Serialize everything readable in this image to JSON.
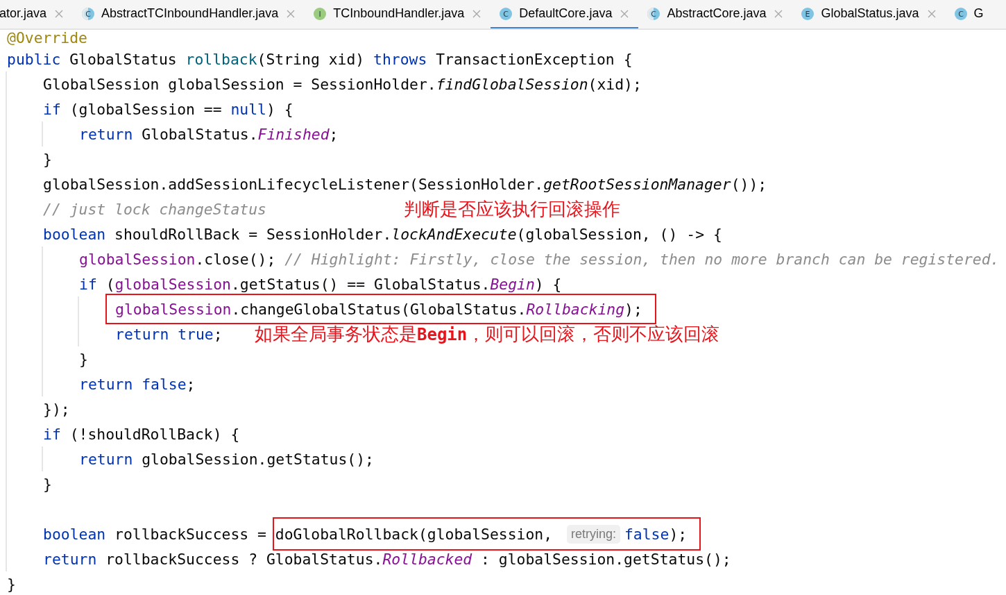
{
  "tabs": [
    {
      "label": "ator.java",
      "selected": false,
      "closable": true
    },
    {
      "label": "AbstractTCInboundHandler.java",
      "selected": false,
      "closable": true,
      "icon": {
        "kind": "abstract",
        "letter": "C"
      }
    },
    {
      "label": "TCInboundHandler.java",
      "selected": false,
      "closable": true,
      "icon": {
        "kind": "interface",
        "letter": "I"
      }
    },
    {
      "label": "DefaultCore.java",
      "selected": true,
      "closable": true,
      "icon": {
        "kind": "class",
        "letter": "C"
      }
    },
    {
      "label": "AbstractCore.java",
      "selected": false,
      "closable": true,
      "icon": {
        "kind": "abstract",
        "letter": "C"
      }
    },
    {
      "label": "GlobalStatus.java",
      "selected": false,
      "closable": true,
      "icon": {
        "kind": "enum",
        "letter": "E"
      }
    },
    {
      "label": "G",
      "selected": false,
      "closable": false,
      "icon": {
        "kind": "class",
        "letter": "C"
      }
    }
  ],
  "code": [
    {
      "kind": "line",
      "tokens": [
        {
          "kind": "annotation",
          "text": "@Override"
        }
      ]
    },
    {
      "kind": "line",
      "tokens": [
        {
          "kind": "keyword",
          "text": "public "
        },
        {
          "kind": "plain",
          "text": "GlobalStatus "
        },
        {
          "kind": "declaration",
          "text": "rollback"
        },
        {
          "kind": "plain",
          "text": "(String xid) "
        },
        {
          "kind": "keyword",
          "text": "throws "
        },
        {
          "kind": "plain",
          "text": "TransactionException {"
        }
      ]
    },
    {
      "kind": "block",
      "children": [
        {
          "kind": "line",
          "tokens": [
            {
              "kind": "plain",
              "text": "GlobalSession globalSession = SessionHolder."
            },
            {
              "kind": "static",
              "text": "findGlobalSession"
            },
            {
              "kind": "plain",
              "text": "(xid);"
            }
          ]
        },
        {
          "kind": "line",
          "tokens": [
            {
              "kind": "keyword",
              "text": "if "
            },
            {
              "kind": "plain",
              "text": "(globalSession == "
            },
            {
              "kind": "keyword",
              "text": "null"
            },
            {
              "kind": "plain",
              "text": ") {"
            }
          ]
        },
        {
          "kind": "block",
          "children": [
            {
              "kind": "line",
              "tokens": [
                {
                  "kind": "keyword",
                  "text": "return "
                },
                {
                  "kind": "plain",
                  "text": "GlobalStatus."
                },
                {
                  "kind": "constant",
                  "text": "Finished"
                },
                {
                  "kind": "plain",
                  "text": ";"
                }
              ]
            }
          ]
        },
        {
          "kind": "line",
          "tokens": [
            {
              "kind": "plain",
              "text": "}"
            }
          ]
        },
        {
          "kind": "line",
          "tokens": [
            {
              "kind": "plain",
              "text": "globalSession.addSessionLifecycleListener(SessionHolder."
            },
            {
              "kind": "static",
              "text": "getRootSessionManager"
            },
            {
              "kind": "plain",
              "text": "());"
            }
          ]
        },
        {
          "kind": "line",
          "tokens": [
            {
              "kind": "comment",
              "text": "// just lock changeStatus"
            },
            {
              "kind": "note",
              "text": "判断是否应该执行回滚操作"
            }
          ]
        },
        {
          "kind": "line",
          "tokens": [
            {
              "kind": "keyword",
              "text": "boolean "
            },
            {
              "kind": "plain",
              "text": "shouldRollBack = SessionHolder."
            },
            {
              "kind": "static",
              "text": "lockAndExecute"
            },
            {
              "kind": "plain",
              "text": "(globalSession, () -> {"
            }
          ]
        },
        {
          "kind": "block",
          "children": [
            {
              "kind": "line",
              "tokens": [
                {
                  "kind": "field",
                  "text": "globalSession"
                },
                {
                  "kind": "plain",
                  "text": ".close(); "
                },
                {
                  "kind": "comment",
                  "text": "// Highlight: Firstly, close the session, then no more branch can be registered."
                }
              ]
            },
            {
              "kind": "line",
              "tokens": [
                {
                  "kind": "keyword",
                  "text": "if "
                },
                {
                  "kind": "plain",
                  "text": "("
                },
                {
                  "kind": "field",
                  "text": "globalSession"
                },
                {
                  "kind": "plain",
                  "text": ".getStatus() == GlobalStatus."
                },
                {
                  "kind": "constant",
                  "text": "Begin"
                },
                {
                  "kind": "plain",
                  "text": ") {"
                }
              ]
            },
            {
              "kind": "block",
              "children": [
                {
                  "kind": "line",
                  "tokens": [
                    {
                      "kind": "boxed",
                      "tokens": [
                        {
                          "kind": "field",
                          "text": "globalSession"
                        },
                        {
                          "kind": "plain",
                          "text": ".changeGlobalStatus(GlobalStatus."
                        },
                        {
                          "kind": "constant",
                          "text": "Rollbacking"
                        },
                        {
                          "kind": "plain",
                          "text": ");"
                        }
                      ]
                    }
                  ]
                },
                {
                  "kind": "line",
                  "tokens": [
                    {
                      "kind": "keyword",
                      "text": "return "
                    },
                    {
                      "kind": "keyword",
                      "text": "true"
                    },
                    {
                      "kind": "plain",
                      "text": ";"
                    },
                    {
                      "kind": "note",
                      "text": "如果全局事务状态是**Begin**，则可以回滚，否则不应该回滚"
                    }
                  ]
                }
              ]
            },
            {
              "kind": "line",
              "tokens": [
                {
                  "kind": "plain",
                  "text": "}"
                }
              ]
            },
            {
              "kind": "line",
              "tokens": [
                {
                  "kind": "keyword",
                  "text": "return "
                },
                {
                  "kind": "keyword",
                  "text": "false"
                },
                {
                  "kind": "plain",
                  "text": ";"
                }
              ]
            }
          ]
        },
        {
          "kind": "line",
          "tokens": [
            {
              "kind": "plain",
              "text": "});"
            }
          ]
        },
        {
          "kind": "line",
          "tokens": [
            {
              "kind": "keyword",
              "text": "if "
            },
            {
              "kind": "plain",
              "text": "(!shouldRollBack) {"
            }
          ]
        },
        {
          "kind": "block",
          "children": [
            {
              "kind": "line",
              "tokens": [
                {
                  "kind": "keyword",
                  "text": "return "
                },
                {
                  "kind": "plain",
                  "text": "globalSession.getStatus();"
                }
              ]
            }
          ]
        },
        {
          "kind": "line",
          "tokens": [
            {
              "kind": "plain",
              "text": "}"
            }
          ]
        },
        {
          "kind": "line"
        },
        {
          "kind": "line",
          "tokens": [
            {
              "kind": "keyword",
              "text": "boolean "
            },
            {
              "kind": "plain",
              "text": "rollbackSuccess = "
            },
            {
              "kind": "boxed",
              "tokens": [
                {
                  "kind": "plain",
                  "text": "doGlobalRollback(globalSession, "
                },
                {
                  "kind": "hint",
                  "text": "retrying:"
                },
                {
                  "kind": "keyword",
                  "text": "false"
                },
                {
                  "kind": "plain",
                  "text": ");"
                }
              ]
            }
          ]
        },
        {
          "kind": "line",
          "tokens": [
            {
              "kind": "keyword",
              "text": "return "
            },
            {
              "kind": "plain",
              "text": "rollbackSuccess ? GlobalStatus."
            },
            {
              "kind": "constant",
              "text": "Rollbacked"
            },
            {
              "kind": "plain",
              "text": " : globalSession.getStatus();"
            }
          ]
        }
      ]
    },
    {
      "kind": "line",
      "tokens": [
        {
          "kind": "plain",
          "text": "}"
        }
      ]
    }
  ]
}
